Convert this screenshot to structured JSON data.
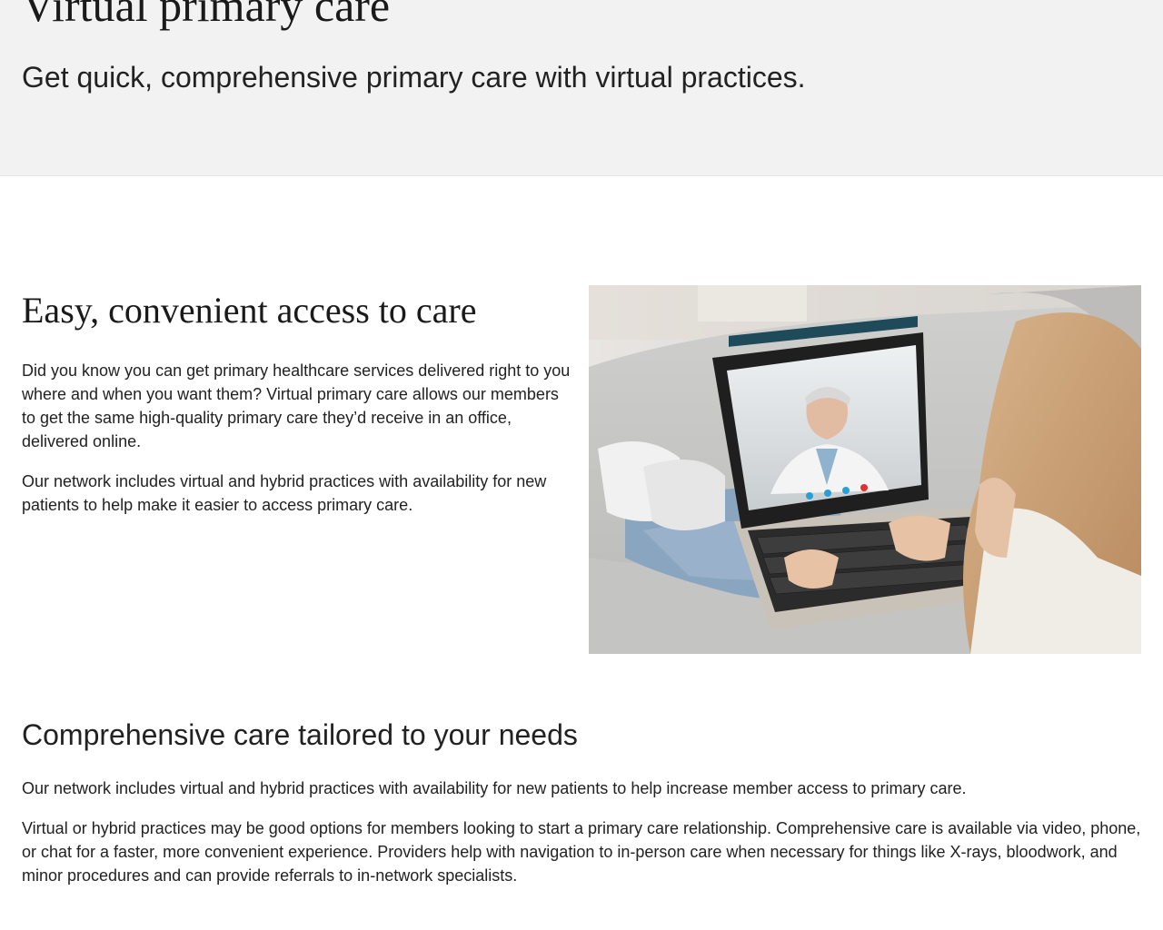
{
  "hero": {
    "title": "Virtual primary care",
    "subtitle": "Get quick, comprehensive primary care with virtual practices."
  },
  "access": {
    "heading": "Easy, convenient access to care",
    "paragraphs": [
      "Did you know you can get primary healthcare services delivered right to you where and when you want them? Virtual primary care allows our members to get the same high-quality primary care they’d receive in an office, delivered online.",
      "Our network includes virtual and hybrid practices with availability for new patients to help make it easier to access primary care."
    ],
    "image_icon": "photo-woman-video-call-with-doctor-on-laptop"
  },
  "care": {
    "heading": "Comprehensive care tailored to your needs",
    "paragraphs": [
      "Our network includes virtual and hybrid practices with availability for new patients to help increase member access to primary care.",
      "Virtual or hybrid practices may be good options for members looking to start a primary care relationship. Comprehensive care is available via video, phone, or chat for a faster, more convenient experience. Providers help with navigation to in-person care when necessary for things like X-rays, bloodwork, and minor procedures and can provide referrals to in-network specialists."
    ]
  },
  "colors": {
    "hero_background": "#f2f2f2",
    "text": "#222222",
    "page_background": "#ffffff"
  }
}
